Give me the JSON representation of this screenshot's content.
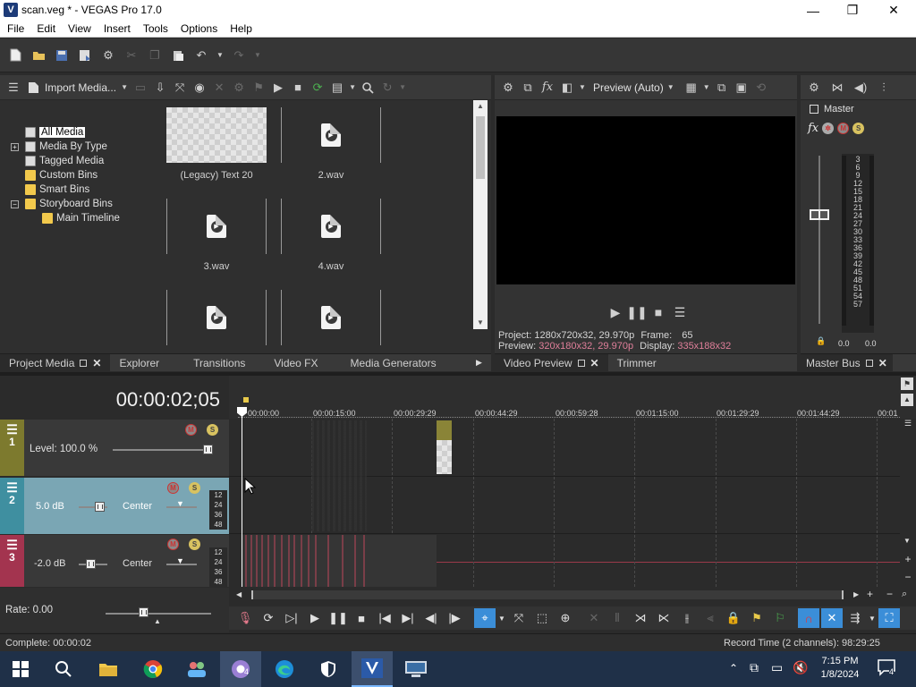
{
  "window": {
    "title": "scan.veg * - VEGAS Pro 17.0",
    "logo_letter": "V",
    "controls": {
      "minimize": "—",
      "maximize": "❐",
      "close": "✕"
    }
  },
  "menu": [
    "File",
    "Edit",
    "View",
    "Insert",
    "Tools",
    "Options",
    "Help"
  ],
  "project_media": {
    "import_label": "Import Media...",
    "tree": [
      {
        "label": "All Media",
        "selected": true
      },
      {
        "label": "Media By Type"
      },
      {
        "label": "Tagged Media"
      },
      {
        "label": "Custom Bins"
      },
      {
        "label": "Smart Bins"
      },
      {
        "label": "Storyboard Bins"
      },
      {
        "label": "Main Timeline"
      }
    ],
    "tree_expanders": {
      "plus": "+",
      "minus": "−"
    },
    "media": [
      {
        "label": "(Legacy) Text 20"
      },
      {
        "label": "2.wav"
      },
      {
        "label": "3.wav"
      },
      {
        "label": "4.wav"
      }
    ]
  },
  "left_tabs": [
    "Project Media",
    "Explorer",
    "Transitions",
    "Video FX",
    "Media Generators"
  ],
  "preview": {
    "mode": "Preview (Auto)",
    "project_label": "Project:",
    "project_value": "1280x720x32, 29.970p",
    "frame_label": "Frame:",
    "frame_value": "65",
    "preview_label": "Preview:",
    "preview_value": "320x180x32, 29.970p",
    "display_label": "Display:",
    "display_value": "335x188x32",
    "tabs": [
      "Video Preview",
      "Trimmer"
    ]
  },
  "master": {
    "label": "Master",
    "fx_label": "fx",
    "scale": [
      "3",
      "6",
      "9",
      "12",
      "15",
      "18",
      "21",
      "24",
      "27",
      "30",
      "33",
      "36",
      "39",
      "42",
      "45",
      "48",
      "51",
      "54",
      "57"
    ],
    "left_value": "0.0",
    "right_value": "0.0",
    "tab": "Master Bus"
  },
  "timeline": {
    "timecode": "00:00:02;05",
    "ruler": [
      "00:00:00",
      "00:00:15:00",
      "00:00:29:29",
      "00:00:44:29",
      "00:00:59:28",
      "00:01:15:00",
      "00:01:29:29",
      "00:01:44:29",
      "00:01"
    ],
    "tracks": [
      {
        "num": "1",
        "level": "Level: 100.0 %",
        "color": "#7d7a2e"
      },
      {
        "num": "2",
        "volume": "5.0 dB",
        "pan": "Center",
        "color": "#3f8fa0"
      },
      {
        "num": "3",
        "volume": "-2.0 dB",
        "pan": "Center",
        "color": "#a3344f"
      }
    ],
    "db_scale": [
      "12",
      "24",
      "36",
      "48"
    ],
    "rate": "Rate: 0.00",
    "mute_label": "M",
    "solo_label": "S"
  },
  "status": {
    "left": "Complete: 00:00:02",
    "right": "Record Time (2 channels): 98:29:25"
  },
  "taskbar": {
    "time": "7:15 PM",
    "date": "1/8/2024",
    "notification_count": "4",
    "chrome_badge": "4"
  }
}
